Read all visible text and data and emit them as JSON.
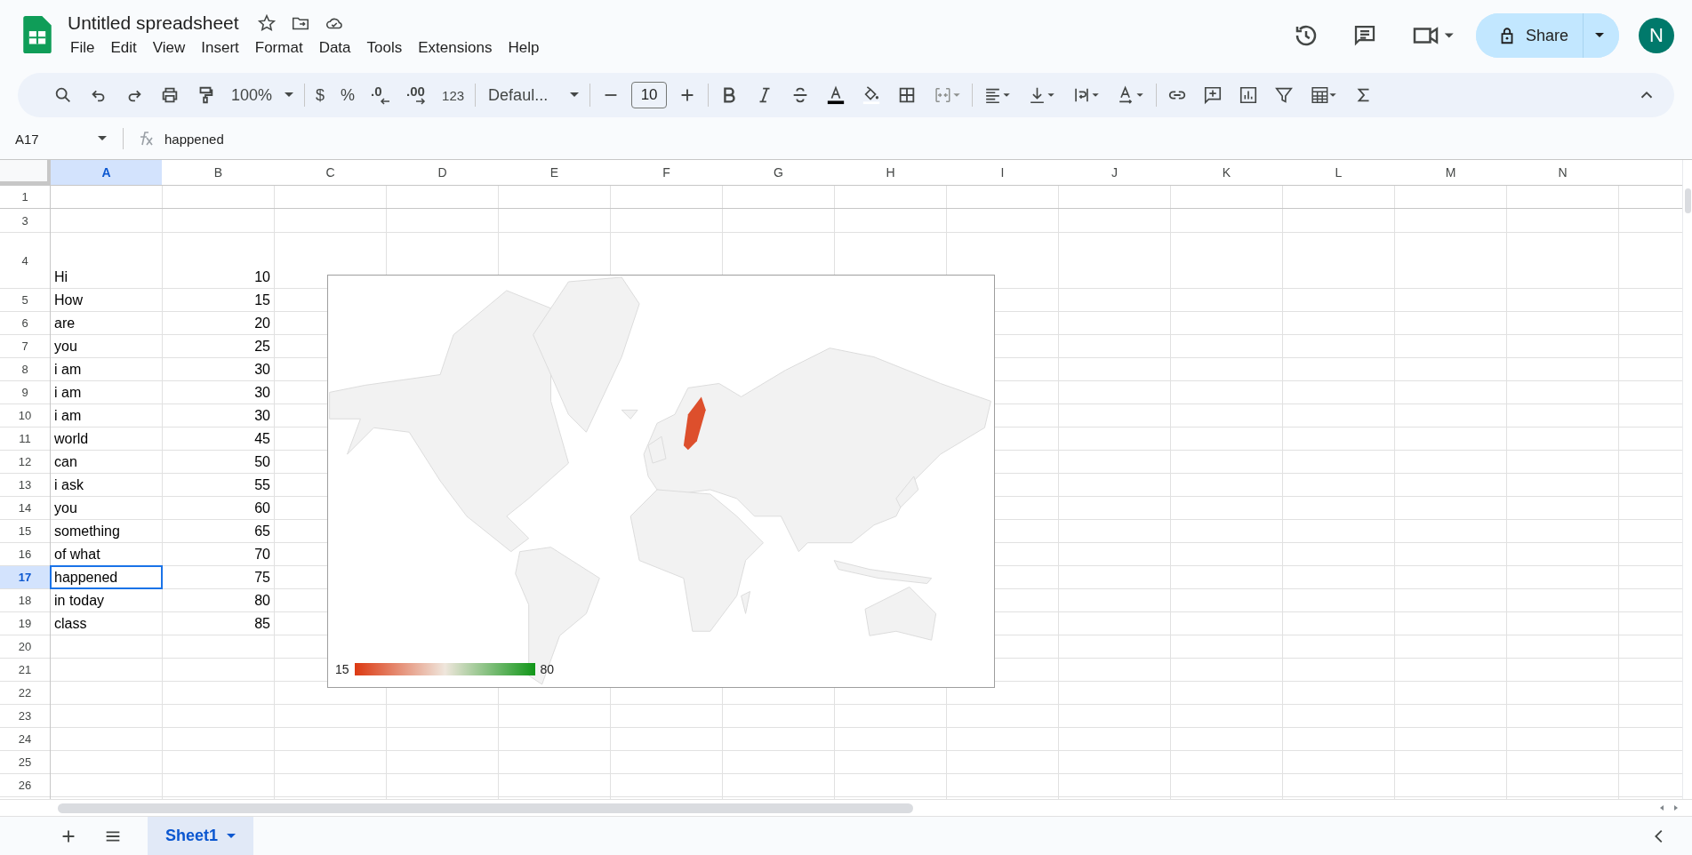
{
  "title": "Untitled spreadsheet",
  "menu": [
    "File",
    "Edit",
    "View",
    "Insert",
    "Format",
    "Data",
    "Tools",
    "Extensions",
    "Help"
  ],
  "share": {
    "label": "Share"
  },
  "avatar": "N",
  "toolbar": {
    "zoom": "100%",
    "currency": "$",
    "percent": "%",
    "decrease_decimals": ".0",
    "increase_decimals": ".00",
    "number_format": "123",
    "font": "Defaul...",
    "font_size": "10"
  },
  "name_box": "A17",
  "formula": "happened",
  "columns": [
    {
      "label": "A",
      "selected": true
    },
    {
      "label": "B",
      "selected": false
    },
    {
      "label": "C",
      "selected": false
    },
    {
      "label": "D",
      "selected": false
    },
    {
      "label": "E",
      "selected": false
    },
    {
      "label": "F",
      "selected": false
    },
    {
      "label": "G",
      "selected": false
    },
    {
      "label": "H",
      "selected": false
    },
    {
      "label": "I",
      "selected": false
    },
    {
      "label": "J",
      "selected": false
    },
    {
      "label": "K",
      "selected": false
    },
    {
      "label": "L",
      "selected": false
    },
    {
      "label": "M",
      "selected": false
    },
    {
      "label": "N",
      "selected": false
    }
  ],
  "rows": [
    {
      "number": "1",
      "kind": "normal",
      "selected": false
    },
    {
      "number": "3",
      "kind": "after-hidden",
      "selected": false
    },
    {
      "number": "4",
      "kind": "tall",
      "selected": false,
      "a": "Hi",
      "b": "10"
    },
    {
      "number": "5",
      "kind": "normal",
      "selected": false,
      "a": "How",
      "b": "15"
    },
    {
      "number": "6",
      "kind": "normal",
      "selected": false,
      "a": "are",
      "b": "20"
    },
    {
      "number": "7",
      "kind": "normal",
      "selected": false,
      "a": "you",
      "b": "25"
    },
    {
      "number": "8",
      "kind": "normal",
      "selected": false,
      "a": "i am",
      "b": "30"
    },
    {
      "number": "9",
      "kind": "normal",
      "selected": false,
      "a": "i am",
      "b": "30"
    },
    {
      "number": "10",
      "kind": "normal",
      "selected": false,
      "a": "i am",
      "b": "30"
    },
    {
      "number": "11",
      "kind": "normal",
      "selected": false,
      "a": "world",
      "b": "45"
    },
    {
      "number": "12",
      "kind": "normal",
      "selected": false,
      "a": "can",
      "b": "50"
    },
    {
      "number": "13",
      "kind": "normal",
      "selected": false,
      "a": "i ask",
      "b": "55"
    },
    {
      "number": "14",
      "kind": "normal",
      "selected": false,
      "a": "you",
      "b": "60"
    },
    {
      "number": "15",
      "kind": "normal",
      "selected": false,
      "a": "something",
      "b": "65"
    },
    {
      "number": "16",
      "kind": "normal",
      "selected": false,
      "a": "of what",
      "b": "70"
    },
    {
      "number": "17",
      "kind": "normal",
      "selected": true,
      "a": "happened",
      "b": "75"
    },
    {
      "number": "18",
      "kind": "normal",
      "selected": false,
      "a": "in today",
      "b": "80"
    },
    {
      "number": "19",
      "kind": "normal",
      "selected": false,
      "a": "class",
      "b": "85"
    },
    {
      "number": "20",
      "kind": "normal",
      "selected": false
    },
    {
      "number": "21",
      "kind": "normal",
      "selected": false
    },
    {
      "number": "22",
      "kind": "normal",
      "selected": false
    },
    {
      "number": "23",
      "kind": "normal",
      "selected": false
    },
    {
      "number": "24",
      "kind": "normal",
      "selected": false
    },
    {
      "number": "25",
      "kind": "normal",
      "selected": false
    },
    {
      "number": "26",
      "kind": "normal",
      "selected": false
    }
  ],
  "chart": {
    "legend_min": "15",
    "legend_max": "80"
  },
  "sheets": [
    {
      "label": "Sheet1",
      "selected": true
    }
  ]
}
